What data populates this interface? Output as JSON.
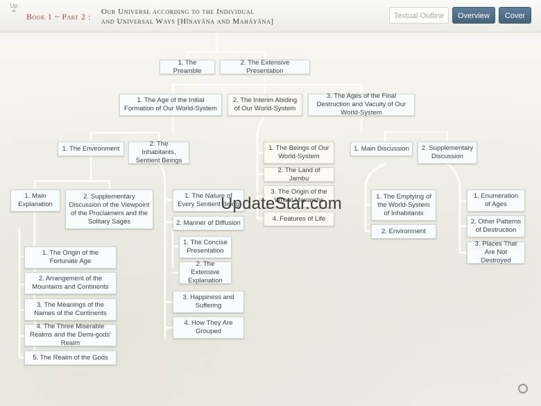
{
  "header": {
    "up_label": "Up",
    "up_icon": "chevron-up-icon",
    "breadcrumb": "Book 1 ~ Part 2 :",
    "title_line1": "Our Universe according to the Individual",
    "title_line2": "and Universal Ways [Hīnayāna and Mahāyāna]",
    "textual_outline": "Textual Outline",
    "overview": "Overview",
    "cover": "Cover"
  },
  "outline": {
    "preamble": "1. The Preamble",
    "extensive_presentation": "2. The Extensive Presentation",
    "initial_formation": "1. The Age of the Initial Formation of Our World-System",
    "interim_abiding": "2. The Interim Abiding of Our World-System",
    "final_destruction": "3. The Ages of the Final Destruction and Vacuity of Our World-System",
    "environment": "1. The Environment",
    "inhabitants": "2. The Inhabitants, Sentient Beings",
    "main_explanation": "1. Main Explanation",
    "supplementary_viewpoint": "2. Supplementary Discussion of the Viewpoint of the Proclaimers and the Solitary Sages",
    "fortunate_age": "1. The Origin of the Fortunate Age",
    "mountains_continents": "2. Arrangement of the Mountains and Continents",
    "names_continents": "3. The Meanings of the Names of the Continents",
    "miserable_realms": "4. The Three Miserable Realms and the Demi-gods' Realm",
    "realm_gods": "5. The Realm of the Gods",
    "nature_beings": "1. The Nature of Every Sentient Being",
    "manner_diffusion": "2. Manner of Diffusion",
    "concise_presentation": "1. The Concise Presentation",
    "extensive_explanation": "2. The Extensive Explanation",
    "happiness_suffering": "3. Happiness and Suffering",
    "how_grouped": "4. How They Are Grouped",
    "beings_world": "1. The Beings of Our World-System",
    "land_jambu": "2. The Land of Jambu",
    "wheel_monarchs": "3. The Origin of the Wheel Monarchs",
    "features_life": "4. Features of Life",
    "main_discussion": "1. Main Discussion",
    "supplementary_discussion": "2. Supplementary Discussion",
    "emptying_inhabitants": "1. The Emptying of the World-System of Inhabitants",
    "environment_destruction": "2. Environment",
    "enumeration_ages": "1. Enumeration of Ages",
    "patterns_destruction": "2. Other Patterns of Destruction",
    "places_not_destroyed": "3. Places That Are Not Destroyed"
  },
  "watermark": "UpdateStar.com",
  "colors": {
    "crumb": "#a5473a",
    "dark_button": "#4f6c86",
    "node_border": "#c9d4d4",
    "connector": "#ffffff"
  }
}
